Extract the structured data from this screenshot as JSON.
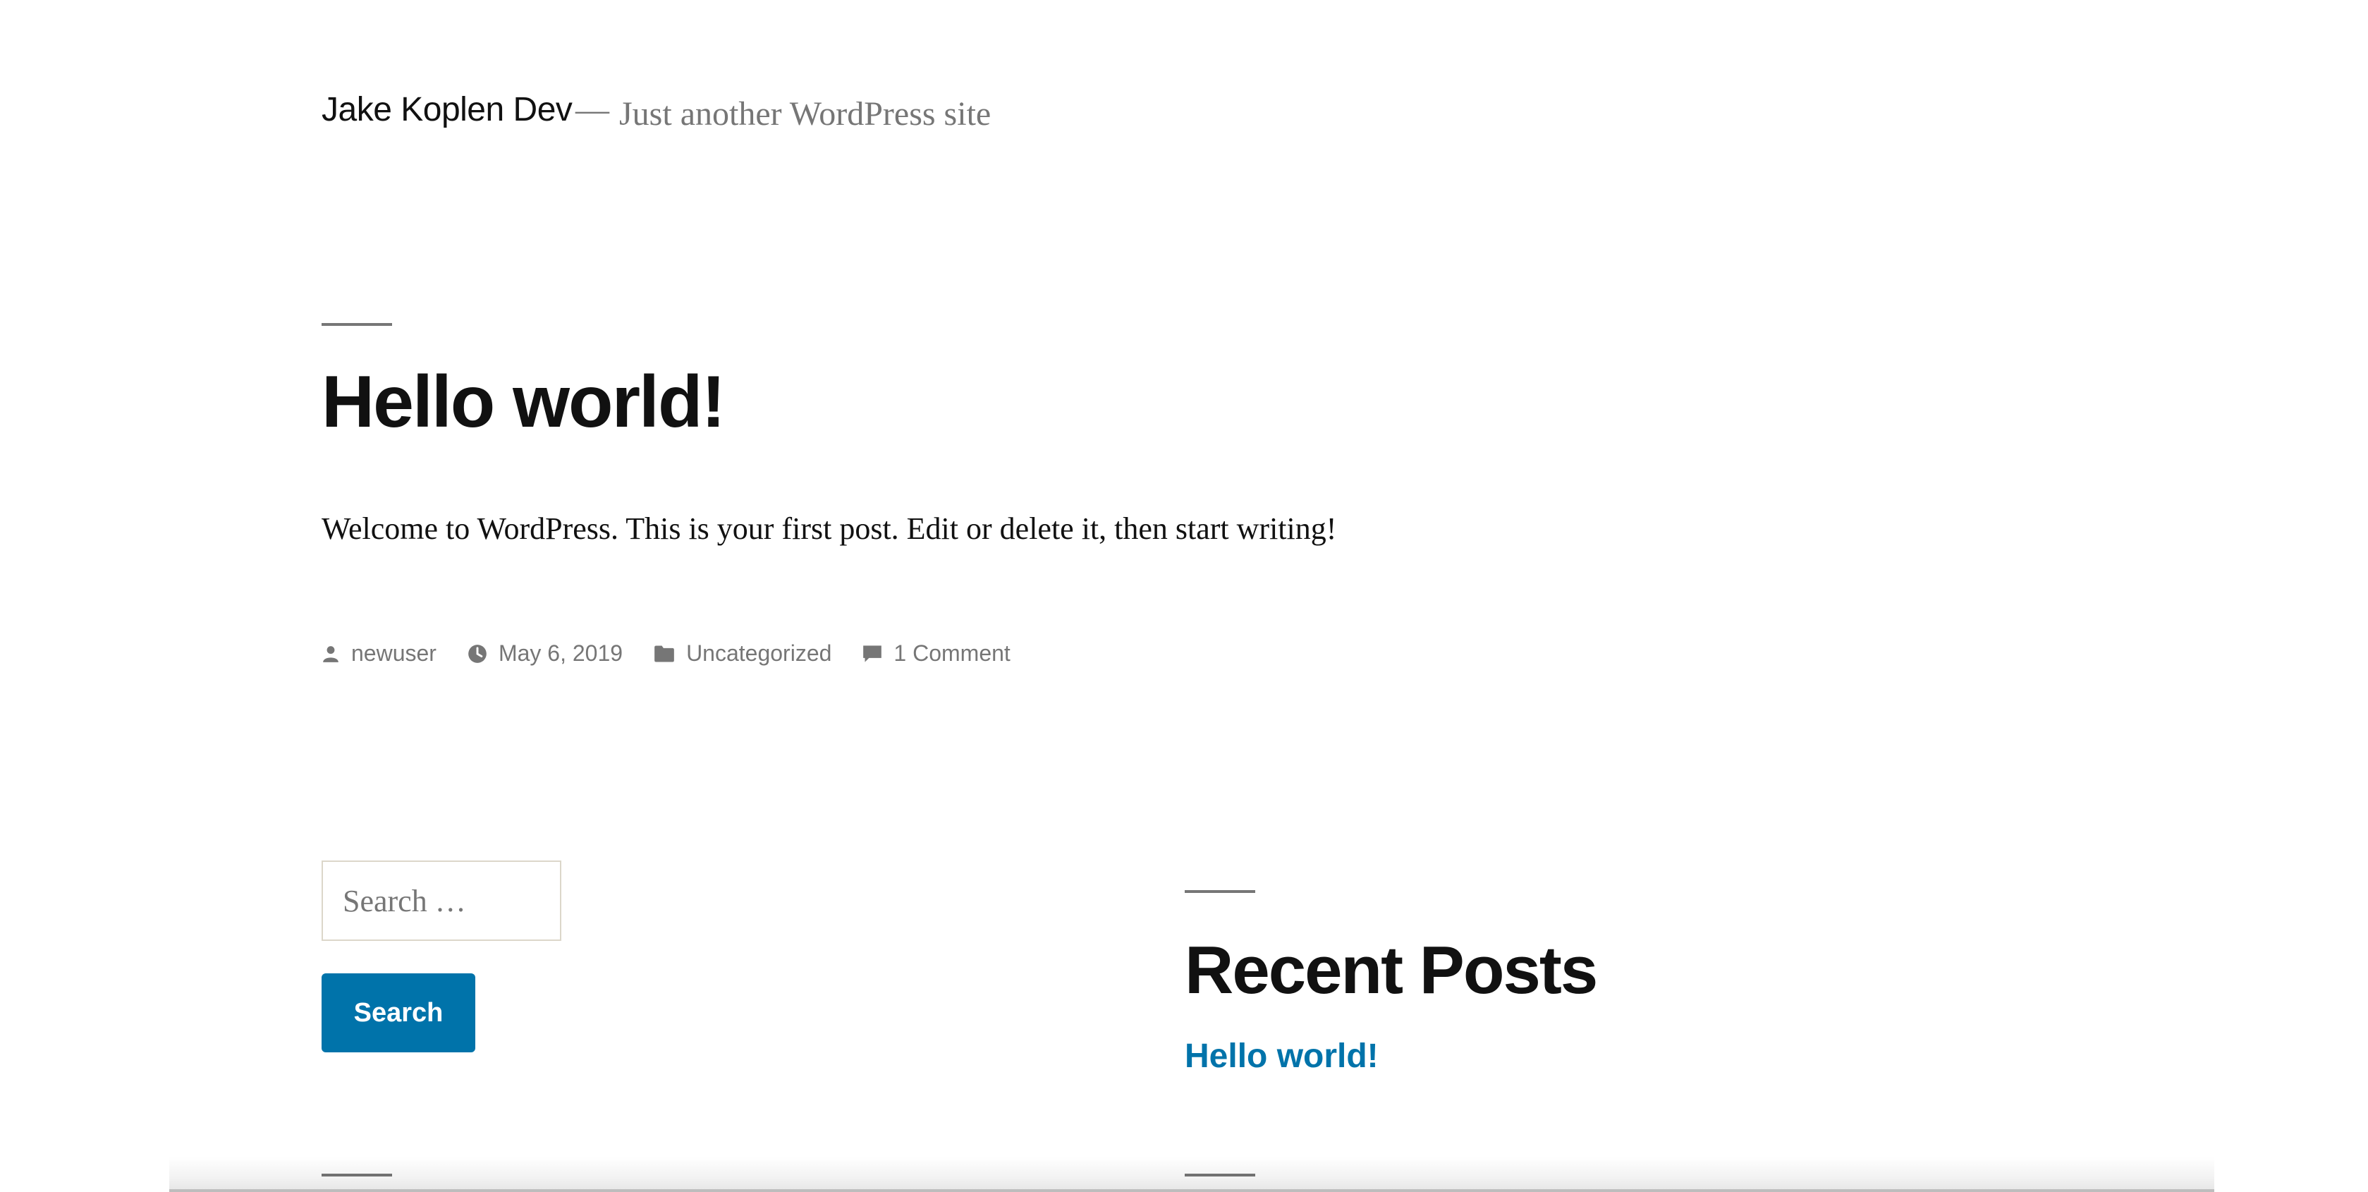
{
  "header": {
    "site_title": "Jake Koplen Dev",
    "separator": "—",
    "tagline": "Just another WordPress site"
  },
  "post": {
    "title": "Hello world!",
    "content": "Welcome to WordPress. This is your first post. Edit or delete it, then start writing!",
    "meta": {
      "author": "newuser",
      "date": "May 6, 2019",
      "category": "Uncategorized",
      "comments": "1 Comment"
    }
  },
  "search_widget": {
    "placeholder": "Search …",
    "button_label": "Search"
  },
  "recent_posts_widget": {
    "title": "Recent Posts",
    "items": [
      {
        "label": "Hello world!"
      }
    ]
  },
  "colors": {
    "accent": "#0073aa",
    "text": "#111111",
    "secondary": "#767676"
  },
  "icons": {
    "author": "person-icon",
    "date": "clock-icon",
    "category": "folder-icon",
    "comments": "comment-icon"
  }
}
